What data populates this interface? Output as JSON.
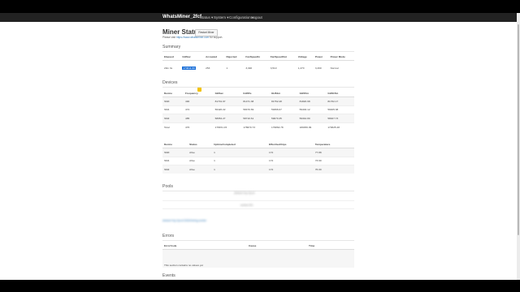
{
  "navbar": {
    "brand": "WhatsMiner_2fcf",
    "items": [
      "Status",
      "System",
      "Configuration",
      "Logout"
    ]
  },
  "page": {
    "title": "Miner Status",
    "restart_button": "Restart Miner",
    "support_prefix": "Please visit ",
    "support_link": "https://www.whatsminer.com",
    "support_suffix": " for support."
  },
  "summary": {
    "heading": "Summary",
    "headers": [
      "Elapsed",
      "GHSav",
      "Accepted",
      "Rejected",
      "FanSpeedIn",
      "FanSpeedOut",
      "Voltage",
      "Power",
      "Power Mode"
    ],
    "row": [
      "20m 3s",
      "174611.60",
      "253",
      "1",
      "3,490",
      "3,510",
      "1,270",
      "3,490",
      "Normal"
    ]
  },
  "devices": {
    "heading": "Devices",
    "headers": [
      "Device",
      "Frequency",
      "GHSav",
      "GHS5s",
      "GHS1m",
      "GHS5m",
      "GHS15m"
    ],
    "rows": [
      [
        "SM0",
        "490",
        "81701.97",
        "81471.38",
        "81752.48",
        "81820.98",
        "81762.17"
      ],
      [
        "SM1",
        "472",
        "56420.22",
        "58470.69",
        "59396.07",
        "59402.12",
        "59405.38"
      ],
      [
        "SM2",
        "485",
        "58654.27",
        "58710.61",
        "59070.35",
        "59342.80",
        "58927.73"
      ],
      [
        "Total",
        "476",
        "178151.15",
        "178670.73",
        "179864.78",
        "180456.09",
        "179625.28"
      ]
    ]
  },
  "devices2": {
    "headers": [
      "Device",
      "Status",
      "UptimeCompleted",
      "EffectiveChips",
      "Temperature"
    ],
    "rows": [
      [
        "SM0",
        "Alive",
        "1",
        "172",
        "77.88"
      ],
      [
        "SM1",
        "Alive",
        "1",
        "172",
        "73.69"
      ],
      [
        "SM2",
        "Alive",
        "1",
        "172",
        "76.00"
      ]
    ]
  },
  "pools": {
    "heading": "Pools",
    "blurred": [
      "stratum+tcp://pool",
      "worker.001",
      "stratum+tcp://pool:3333/mining.worker"
    ]
  },
  "errors": {
    "heading": "Errors",
    "headers": [
      "ErrorCode",
      "Cause",
      "Time"
    ],
    "empty_text": "This section contains no values yet"
  },
  "events": {
    "heading": "Events"
  }
}
